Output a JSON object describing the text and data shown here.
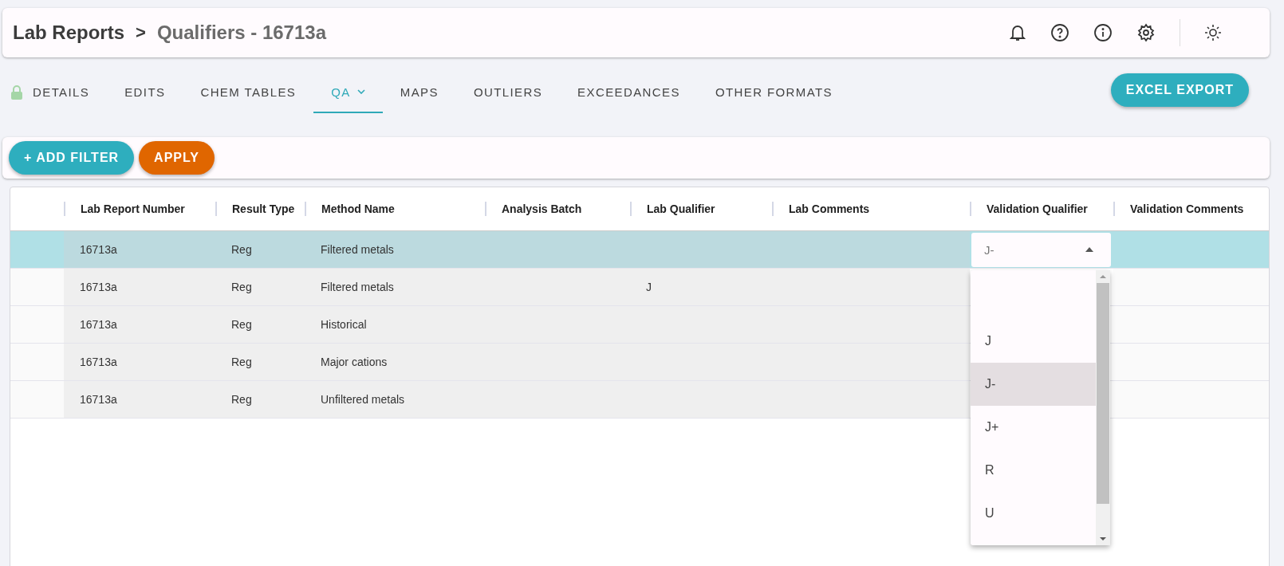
{
  "header": {
    "breadcrumb": [
      "Lab Reports",
      "Qualifiers - 16713a"
    ],
    "separator": ">"
  },
  "tabs": [
    {
      "label": "DETAILS",
      "selected": false
    },
    {
      "label": "EDITS",
      "selected": false
    },
    {
      "label": "CHEM TABLES",
      "selected": false
    },
    {
      "label": "QA",
      "selected": true,
      "has_menu": true
    },
    {
      "label": "MAPS",
      "selected": false
    },
    {
      "label": "OUTLIERS",
      "selected": false
    },
    {
      "label": "EXCEEDANCES",
      "selected": false
    },
    {
      "label": "OTHER FORMATS",
      "selected": false
    }
  ],
  "excel_export": "EXCEL EXPORT",
  "filter_bar": {
    "add_filter": "+ ADD FILTER",
    "apply": "APPLY"
  },
  "table": {
    "columns": [
      "Lab Report Number",
      "Result Type",
      "Method Name",
      "Analysis Batch",
      "Lab Qualifier",
      "Lab Comments",
      "Validation Qualifier",
      "Validation Comments"
    ],
    "rows": [
      {
        "selected": true,
        "cells": [
          "16713a",
          "Reg",
          "Filtered metals",
          "",
          "",
          "",
          "J-",
          ""
        ]
      },
      {
        "selected": false,
        "cells": [
          "16713a",
          "Reg",
          "Filtered metals",
          "",
          "J",
          "",
          "",
          ""
        ]
      },
      {
        "selected": false,
        "cells": [
          "16713a",
          "Reg",
          "Historical",
          "",
          "",
          "",
          "",
          ""
        ]
      },
      {
        "selected": false,
        "cells": [
          "16713a",
          "Reg",
          "Major cations",
          "",
          "",
          "",
          "",
          ""
        ]
      },
      {
        "selected": false,
        "cells": [
          "16713a",
          "Reg",
          "Unfiltered metals",
          "",
          "",
          "",
          "",
          ""
        ]
      }
    ]
  },
  "dropdown": {
    "options": [
      {
        "label": "J",
        "selected": false
      },
      {
        "label": "J-",
        "selected": true
      },
      {
        "label": "J+",
        "selected": false
      },
      {
        "label": "R",
        "selected": false
      },
      {
        "label": "U",
        "selected": false
      }
    ]
  }
}
